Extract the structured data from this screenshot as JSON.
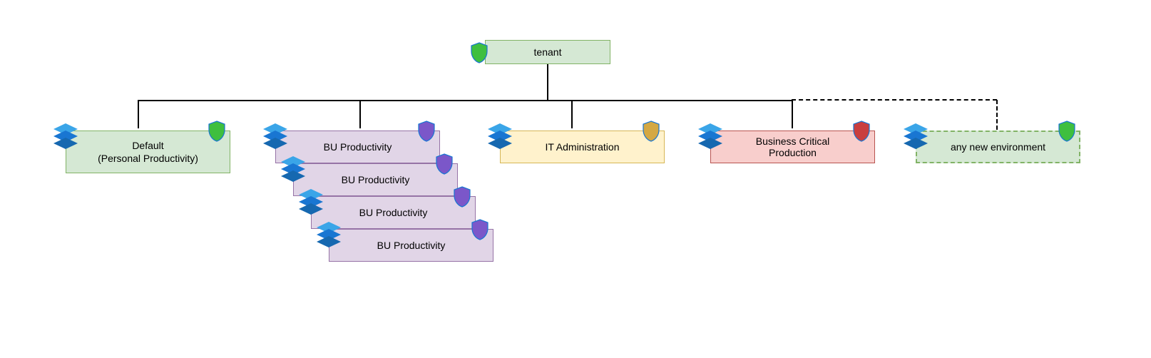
{
  "tenant": {
    "label": "tenant"
  },
  "environments": {
    "default": {
      "line1": "Default",
      "line2": "(Personal Productivity)"
    },
    "bu1": {
      "label": "BU Productivity"
    },
    "bu2": {
      "label": "BU Productivity"
    },
    "bu3": {
      "label": "BU Productivity"
    },
    "bu4": {
      "label": "BU Productivity"
    },
    "it": {
      "label": "IT Administration"
    },
    "critical": {
      "line1": "Business Critical",
      "line2": "Production"
    },
    "new": {
      "label": "any new environment"
    }
  },
  "colors": {
    "shield_green": "#3fbf3f",
    "shield_purple": "#7b57c9",
    "shield_gold": "#d4a843",
    "shield_red": "#c93e3e",
    "layers_light": "#3aa5e8",
    "layers_dark": "#1976d2"
  }
}
